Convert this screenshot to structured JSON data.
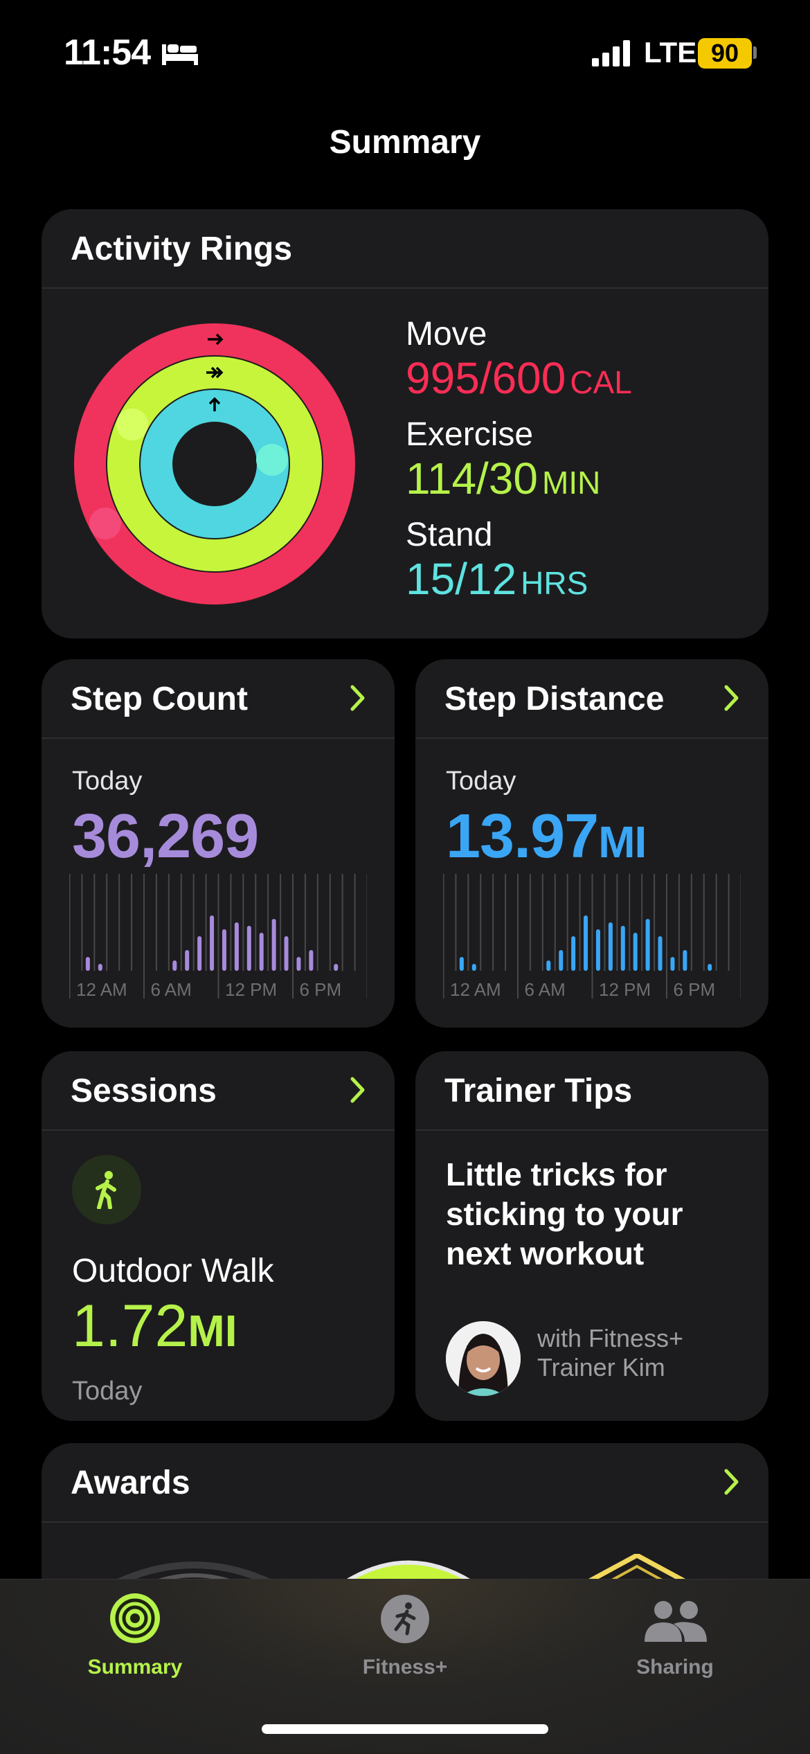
{
  "status_bar": {
    "time": "11:54",
    "network": "LTE",
    "battery": "90"
  },
  "page_title": "Summary",
  "activity_rings": {
    "title": "Activity Rings",
    "move": {
      "label": "Move",
      "value": "995/600",
      "unit": "CAL",
      "progress": 1.658,
      "color": "#fa2d55"
    },
    "exercise": {
      "label": "Exercise",
      "value": "114/30",
      "unit": "MIN",
      "progress": 3.8,
      "color": "#b6f24a"
    },
    "stand": {
      "label": "Stand",
      "value": "15/12",
      "unit": "HRS",
      "progress": 1.25,
      "color": "#5ee3e0"
    }
  },
  "step_count": {
    "title": "Step Count",
    "period": "Today",
    "value": "36,269",
    "color": "#a78bdb",
    "hourly": [
      0,
      0.2,
      0.1,
      0,
      0,
      0,
      0,
      0,
      0.15,
      0.3,
      0.5,
      0.8,
      0.6,
      0.7,
      0.65,
      0.55,
      0.75,
      0.5,
      0.2,
      0.3,
      0,
      0.1,
      0,
      0
    ],
    "ticks": [
      "12 AM",
      "6 AM",
      "12 PM",
      "6 PM"
    ]
  },
  "step_distance": {
    "title": "Step Distance",
    "period": "Today",
    "value": "13.97",
    "unit": "MI",
    "color": "#3aa6f5",
    "hourly": [
      0,
      0.2,
      0.1,
      0,
      0,
      0,
      0,
      0,
      0.15,
      0.3,
      0.5,
      0.8,
      0.6,
      0.7,
      0.65,
      0.55,
      0.75,
      0.5,
      0.2,
      0.3,
      0,
      0.1,
      0,
      0
    ],
    "ticks": [
      "12 AM",
      "6 AM",
      "12 PM",
      "6 PM"
    ]
  },
  "sessions": {
    "title": "Sessions",
    "icon": "walk-icon",
    "workout": "Outdoor Walk",
    "value": "1.72",
    "unit": "MI",
    "date": "Today"
  },
  "trainer_tips": {
    "title": "Trainer Tips",
    "text": "Little tricks for sticking to your next workout",
    "author_line1": "with Fitness+",
    "author_line2": "Trainer Kim"
  },
  "awards": {
    "title": "Awards"
  },
  "tabs": [
    {
      "label": "Summary",
      "icon": "activity-rings-icon",
      "active": true,
      "color": "#b6f24a"
    },
    {
      "label": "Fitness+",
      "icon": "runner-icon",
      "active": false,
      "color": "#8e8e93"
    },
    {
      "label": "Sharing",
      "icon": "people-icon",
      "active": false,
      "color": "#8e8e93"
    }
  ]
}
